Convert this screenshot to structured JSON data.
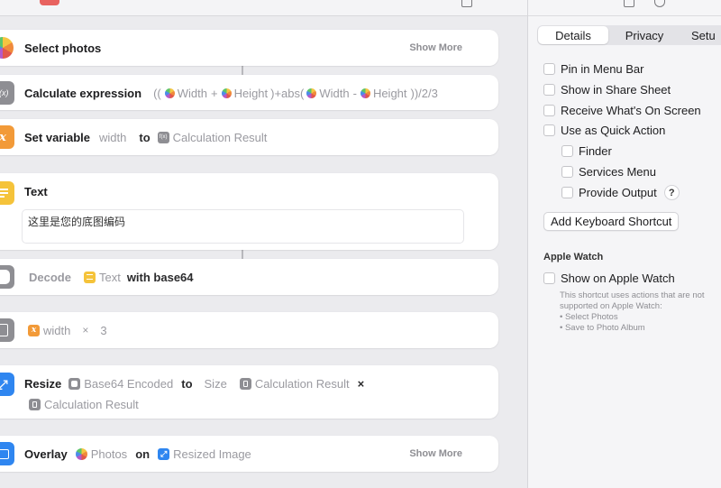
{
  "colors": {
    "photos_gray": "#eaeaec",
    "calc_gray": "#8e8e93",
    "variable_orange": "#f29a38",
    "text_yellow": "#f5c33a",
    "decode_gray": "#8e8e93",
    "resize_blue": "#2f86f0",
    "overlay_blue": "#2f86f0"
  },
  "actions": {
    "select_photos": {
      "icon": "photos-icon",
      "title": "Select photos",
      "show_more": "Show More"
    },
    "calculate": {
      "icon": "f(x)",
      "icon_name": "calculate-expression-icon",
      "title": "Calculate expression",
      "open_paren": "((",
      "width1": "Width",
      "plus": "+",
      "height1": "Height",
      "mid": ")+abs(",
      "width2": "Width",
      "minus": "-",
      "height2": "Height",
      "tail": "))/2/3"
    },
    "set_variable": {
      "icon": "x",
      "icon_name": "variable-icon",
      "title": "Set variable",
      "name": "width",
      "to": "to",
      "calc_glyph": "f(x)",
      "value": "Calculation Result"
    },
    "text": {
      "icon": "text-icon",
      "title": "Text",
      "content": "这里是您的底图编码"
    },
    "decode": {
      "icon": "decode-icon",
      "title": "Decode",
      "token": "Text",
      "with": "with base64"
    },
    "calculate2": {
      "icon": "calculator-icon",
      "var": "width",
      "op": "×",
      "value": "3"
    },
    "resize": {
      "icon": "resize-icon",
      "title": "Resize",
      "source": "Base64 Encoded",
      "to": "to",
      "size": "Size",
      "value1": "Calculation Result",
      "times": "×",
      "value2": "Calculation Result"
    },
    "overlay": {
      "icon": "overlay-icon",
      "title": "Overlay",
      "source": "Photos",
      "on": "on",
      "target": "Resized Image",
      "show_more": "Show More"
    }
  },
  "inspector": {
    "tabs": [
      "Details",
      "Privacy",
      "Setu"
    ],
    "checkboxes": {
      "pin_menu_bar": "Pin in Menu Bar",
      "share_sheet": "Show in Share Sheet",
      "receive_screen": "Receive What's On Screen",
      "quick_action": "Use as Quick Action",
      "finder": "Finder",
      "services_menu": "Services Menu",
      "provide_output": "Provide Output"
    },
    "help": "?",
    "keyboard_shortcut": "Add Keyboard Shortcut",
    "apple_watch_title": "Apple Watch",
    "show_apple_watch": "Show on Apple Watch",
    "watch_note": [
      "This shortcut uses actions that are not",
      "supported on Apple Watch:",
      "• Select Photos",
      "• Save to Photo Album"
    ]
  }
}
